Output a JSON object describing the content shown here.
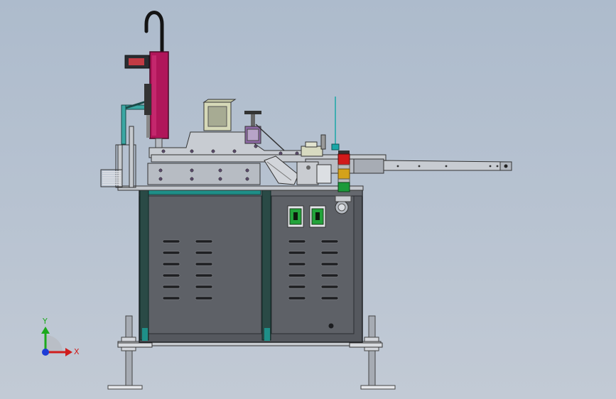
{
  "scene": {
    "background_top": "#adbbcc",
    "background_bottom": "#c2cad5"
  },
  "colors": {
    "cabinet": "#5a5d63",
    "cabinet_frame": "#2f3236",
    "frame_teal": "#1e8f88",
    "post_dark": "#2a4a46",
    "magenta_unit": "#b0165a",
    "steel_plate": "#c8ccd2",
    "rail": "#b3b8c0",
    "switch_green": "#22a33a",
    "light_red": "#d11a1a",
    "light_yellow": "#d4a21a",
    "light_green": "#1c9a3a",
    "antenna": "#1aa7a7",
    "bracket_teal": "#3aa7a3"
  },
  "triad": {
    "y_axis_label": "Y",
    "x_axis_label": "X",
    "y_color": "#1ca91c",
    "x_color": "#d01d1d",
    "z_color": "#1e3cd6"
  },
  "vents": {
    "left_column_count": 6,
    "right_column_count": 6
  }
}
